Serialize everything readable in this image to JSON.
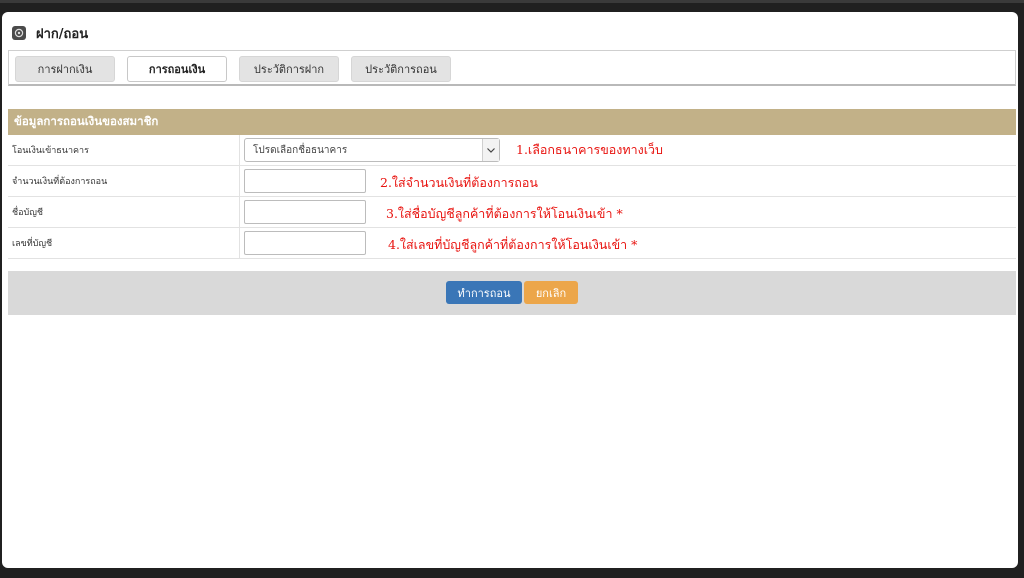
{
  "header": {
    "title": "ฝาก/ถอน",
    "icon": "dashboard-icon"
  },
  "tabs": [
    {
      "label": "การฝากเงิน",
      "active": false
    },
    {
      "label": "การถอนเงิน",
      "active": true
    },
    {
      "label": "ประวัติการฝาก",
      "active": false
    },
    {
      "label": "ประวัติการถอน",
      "active": false
    }
  ],
  "form": {
    "section_title": "ข้อมูลการถอนเงินของสมาชิก",
    "rows": [
      {
        "label": "โอนเงินเข้าธนาคาร",
        "value": "โปรดเลือกชื่อธนาคาร",
        "note": "1.เลือกธนาคารของทางเว็บ"
      },
      {
        "label": "จำนวนเงินที่ต้องการถอน",
        "value": "",
        "note": "2.ใส่จำนวนเงินที่ต้องการถอน"
      },
      {
        "label": "ชื่อบัญชี",
        "value": "",
        "note": "3.ใส่ชื่อบัญชีลูกค้าที่ต้องการให้โอนเงินเข้า *"
      },
      {
        "label": "เลขที่บัญชี",
        "value": "",
        "note": "4.ใส่เลขที่บัญชีลูกค้าที่ต้องการให้โอนเงินเข้า *"
      }
    ]
  },
  "actions": {
    "submit_label": "ทำการถอน",
    "cancel_label": "ยกเลิก"
  },
  "colors": {
    "section_header": "#c2b188",
    "primary_button": "#3a76b7",
    "cancel_button": "#eca64a",
    "note_text": "#e8130f"
  }
}
